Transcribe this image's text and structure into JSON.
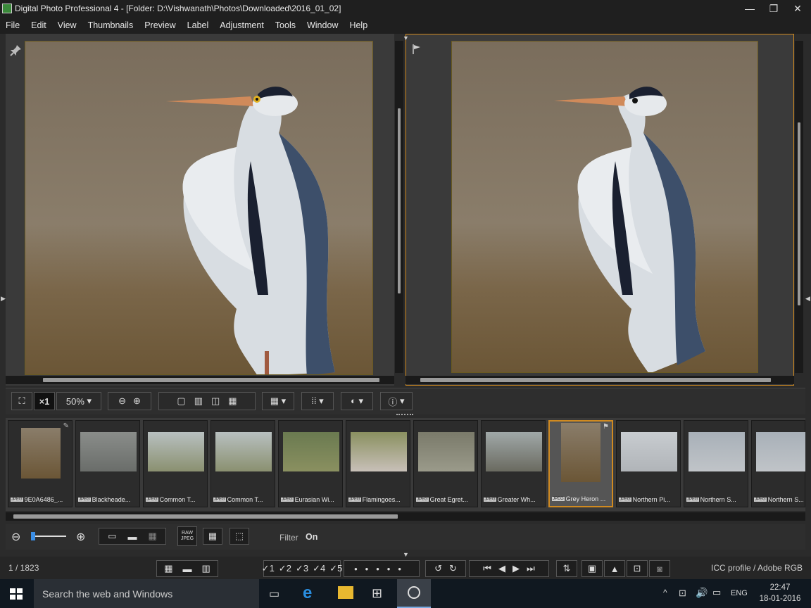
{
  "window": {
    "title": "Digital Photo Professional 4 - [Folder: D:\\Vishwanath\\Photos\\Downloaded\\2016_01_02]",
    "minimize": "—",
    "maximize": "❐",
    "close": "✕"
  },
  "menu": [
    "File",
    "Edit",
    "View",
    "Thumbnails",
    "Preview",
    "Label",
    "Adjustment",
    "Tools",
    "Window",
    "Help"
  ],
  "toolbar": {
    "zoom_multiplier": "×1",
    "zoom_level": "50%"
  },
  "thumbnails": [
    {
      "caption": "9E0A6486_..."
    },
    {
      "caption": "Blackheade..."
    },
    {
      "caption": "Common T..."
    },
    {
      "caption": "Common T..."
    },
    {
      "caption": "Eurasian Wi..."
    },
    {
      "caption": "Flamingoes..."
    },
    {
      "caption": "Great Egret..."
    },
    {
      "caption": "Greater Wh..."
    },
    {
      "caption": "Grey Heron ..."
    },
    {
      "caption": "Northern Pi..."
    },
    {
      "caption": "Northern S..."
    },
    {
      "caption": "Northern S..."
    }
  ],
  "thumb_badge": "JPEG",
  "filter": {
    "label": "Filter",
    "value": "On",
    "raw_jpeg_top": "RAW",
    "raw_jpeg_bottom": "JPEG"
  },
  "status": {
    "count": "1 / 1823",
    "icc": "ICC profile / Adobe RGB",
    "ratings": [
      "1",
      "2",
      "3",
      "4",
      "5"
    ]
  },
  "taskbar": {
    "search_placeholder": "Search the web and Windows",
    "language": "ENG",
    "time": "22:47",
    "date": "18-01-2016"
  }
}
